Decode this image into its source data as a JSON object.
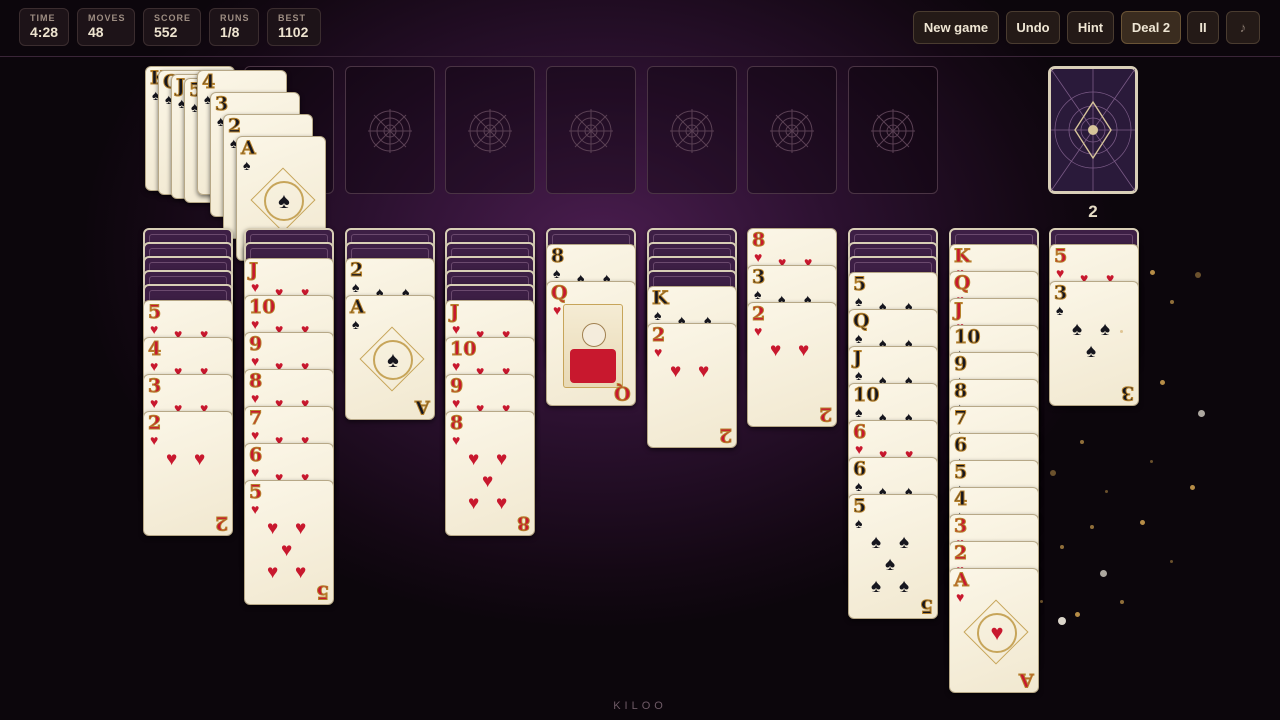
{
  "stats": [
    {
      "label": "TIME",
      "value": "4:28"
    },
    {
      "label": "MOVES",
      "value": "48"
    },
    {
      "label": "SCORE",
      "value": "552"
    },
    {
      "label": "RUNS",
      "value": "1/8"
    },
    {
      "label": "BEST",
      "value": "1102"
    }
  ],
  "toolbar": {
    "new_game": "New game",
    "undo": "Undo",
    "hint": "Hint",
    "deal": "Deal 2",
    "pause": "II",
    "sound": "♪"
  },
  "stock": {
    "count": "2"
  },
  "completed_run": [
    {
      "rank": "K",
      "suit": "♠"
    },
    {
      "rank": "Q",
      "suit": "♠"
    },
    {
      "rank": "J",
      "suit": "♠"
    },
    {
      "rank": "5",
      "suit": "♠"
    },
    {
      "rank": "4",
      "suit": "♠"
    },
    {
      "rank": "3",
      "suit": "♠"
    },
    {
      "rank": "2",
      "suit": "♠"
    },
    {
      "rank": "A",
      "suit": "♠"
    }
  ],
  "tableau": [
    {
      "down": 5,
      "up": [
        {
          "r": "5",
          "s": "♥"
        },
        {
          "r": "4",
          "s": "♥"
        },
        {
          "r": "3",
          "s": "♥"
        },
        {
          "r": "2",
          "s": "♥"
        }
      ]
    },
    {
      "down": 2,
      "up": [
        {
          "r": "J",
          "s": "♥"
        },
        {
          "r": "10",
          "s": "♥"
        },
        {
          "r": "9",
          "s": "♥"
        },
        {
          "r": "8",
          "s": "♥"
        },
        {
          "r": "7",
          "s": "♥"
        },
        {
          "r": "6",
          "s": "♥"
        },
        {
          "r": "5",
          "s": "♥"
        }
      ]
    },
    {
      "down": 2,
      "up": [
        {
          "r": "2",
          "s": "♠"
        },
        {
          "r": "A",
          "s": "♠"
        }
      ]
    },
    {
      "down": 5,
      "up": [
        {
          "r": "J",
          "s": "♥"
        },
        {
          "r": "10",
          "s": "♥"
        },
        {
          "r": "9",
          "s": "♥"
        },
        {
          "r": "8",
          "s": "♥"
        }
      ]
    },
    {
      "down": 1,
      "up": [
        {
          "r": "8",
          "s": "♠"
        },
        {
          "r": "Q",
          "s": "♥"
        }
      ]
    },
    {
      "down": 4,
      "up": [
        {
          "r": "K",
          "s": "♠"
        },
        {
          "r": "2",
          "s": "♥"
        }
      ]
    },
    {
      "down": 0,
      "up": [
        {
          "r": "8",
          "s": "♥"
        },
        {
          "r": "3",
          "s": "♠"
        },
        {
          "r": "2",
          "s": "♥"
        }
      ]
    },
    {
      "down": 3,
      "up": [
        {
          "r": "5",
          "s": "♠"
        },
        {
          "r": "Q",
          "s": "♠"
        },
        {
          "r": "J",
          "s": "♠"
        },
        {
          "r": "10",
          "s": "♠"
        },
        {
          "r": "6",
          "s": "♥"
        },
        {
          "r": "6",
          "s": "♠"
        },
        {
          "r": "5",
          "s": "♠"
        }
      ]
    },
    {
      "down": 1,
      "up": [
        {
          "r": "K",
          "s": "♥"
        },
        {
          "r": "Q",
          "s": "♥"
        },
        {
          "r": "J",
          "s": "♥"
        },
        {
          "r": "10",
          "s": "♠"
        },
        {
          "r": "9",
          "s": "♠"
        },
        {
          "r": "8",
          "s": "♠"
        },
        {
          "r": "7",
          "s": "♠"
        },
        {
          "r": "6",
          "s": "♠"
        },
        {
          "r": "5",
          "s": "♠"
        },
        {
          "r": "4",
          "s": "♠"
        },
        {
          "r": "3",
          "s": "♥"
        },
        {
          "r": "2",
          "s": "♥"
        },
        {
          "r": "A",
          "s": "♥"
        }
      ]
    },
    {
      "down": 1,
      "up": [
        {
          "r": "5",
          "s": "♥"
        },
        {
          "r": "3",
          "s": "♠"
        }
      ]
    }
  ],
  "footer": "KILOO"
}
